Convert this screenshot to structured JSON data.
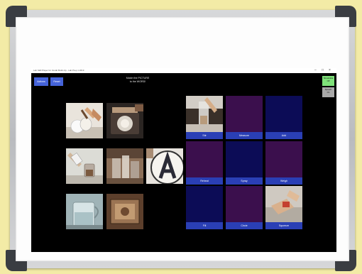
{
  "window": {
    "title": "Lab Skill Player for Vocab Build-Up - Lab Prep 1 2019",
    "minimize": "–",
    "maximize": "□",
    "close": "×"
  },
  "toolbar": {
    "btn1_label": "Actions",
    "btn2_label": "Reset"
  },
  "instruction": {
    "line1": "Match the PICTURE",
    "line2": "to the WORD!"
  },
  "side_buttons": {
    "top_line1": "Show/Hide",
    "top_line2": "Off",
    "bottom_line1": "Speech",
    "bottom_line2": "On"
  },
  "photos": [
    {
      "icon": "pouring-cup-photo"
    },
    {
      "icon": "scale-photo"
    },
    {
      "icon": "beaker-pour-photo"
    },
    {
      "icon": "glassware-photo"
    },
    {
      "icon": "letter-a-photo"
    },
    {
      "icon": "measuring-cup-photo"
    },
    {
      "icon": "tray-photo"
    }
  ],
  "cards": [
    {
      "label": "Stir",
      "state": "photo"
    },
    {
      "label": "Measure",
      "state": "purple"
    },
    {
      "label": "Add",
      "state": "navy"
    },
    {
      "label": "Reheat",
      "state": "purple"
    },
    {
      "label": "Spray",
      "state": "navy"
    },
    {
      "label": "Weigh",
      "state": "purple"
    },
    {
      "label": "Fill",
      "state": "navy"
    },
    {
      "label": "Circle",
      "state": "purple"
    },
    {
      "label": "Squeeze",
      "state": "photo"
    }
  ],
  "colors": {
    "wall": "#f3eba6",
    "button_blue": "#4563d9",
    "label_blue": "#2a3fb5",
    "card_navy": "#0c0c56",
    "card_purple": "#3b0f4d",
    "side_green": "#7fe27a",
    "side_grey": "#a9a9a9"
  }
}
